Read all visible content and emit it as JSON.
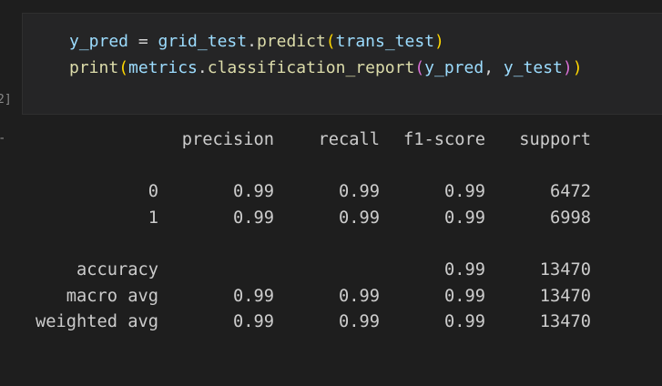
{
  "cell": {
    "prompt": "2]",
    "code_lines": [
      [
        {
          "text": "y_pred",
          "kind": "var"
        },
        {
          "text": " = ",
          "kind": "op"
        },
        {
          "text": "grid_test",
          "kind": "var"
        },
        {
          "text": ".",
          "kind": "op"
        },
        {
          "text": "predict",
          "kind": "fn"
        },
        {
          "text": "(",
          "kind": "p1"
        },
        {
          "text": "trans_test",
          "kind": "var"
        },
        {
          "text": ")",
          "kind": "p1"
        }
      ],
      [
        {
          "text": "print",
          "kind": "fn"
        },
        {
          "text": "(",
          "kind": "p1"
        },
        {
          "text": "metrics",
          "kind": "var"
        },
        {
          "text": ".",
          "kind": "op"
        },
        {
          "text": "classification_report",
          "kind": "fn"
        },
        {
          "text": "(",
          "kind": "p2"
        },
        {
          "text": "y_pred",
          "kind": "var"
        },
        {
          "text": ", ",
          "kind": "op"
        },
        {
          "text": "y_test",
          "kind": "var"
        },
        {
          "text": ")",
          "kind": "p2"
        },
        {
          "text": ")",
          "kind": "p1"
        }
      ]
    ]
  },
  "output": {
    "marker": "-",
    "header": [
      "",
      "precision",
      "recall",
      "f1-score",
      "support"
    ],
    "class_rows": [
      [
        "0",
        "0.99",
        "0.99",
        "0.99",
        "6472"
      ],
      [
        "1",
        "0.99",
        "0.99",
        "0.99",
        "6998"
      ]
    ],
    "summary_rows": [
      [
        "accuracy",
        "",
        "",
        "0.99",
        "13470"
      ],
      [
        "macro avg",
        "0.99",
        "0.99",
        "0.99",
        "13470"
      ],
      [
        "weighted avg",
        "0.99",
        "0.99",
        "0.99",
        "13470"
      ]
    ]
  },
  "colors": {
    "background": "#1e1e1e",
    "cell_background": "#252526",
    "variable": "#9cdcfe",
    "function": "#dcdcaa",
    "bracket_level1": "#ffd700",
    "bracket_level2": "#da70d6",
    "output_text": "#cccccc"
  }
}
